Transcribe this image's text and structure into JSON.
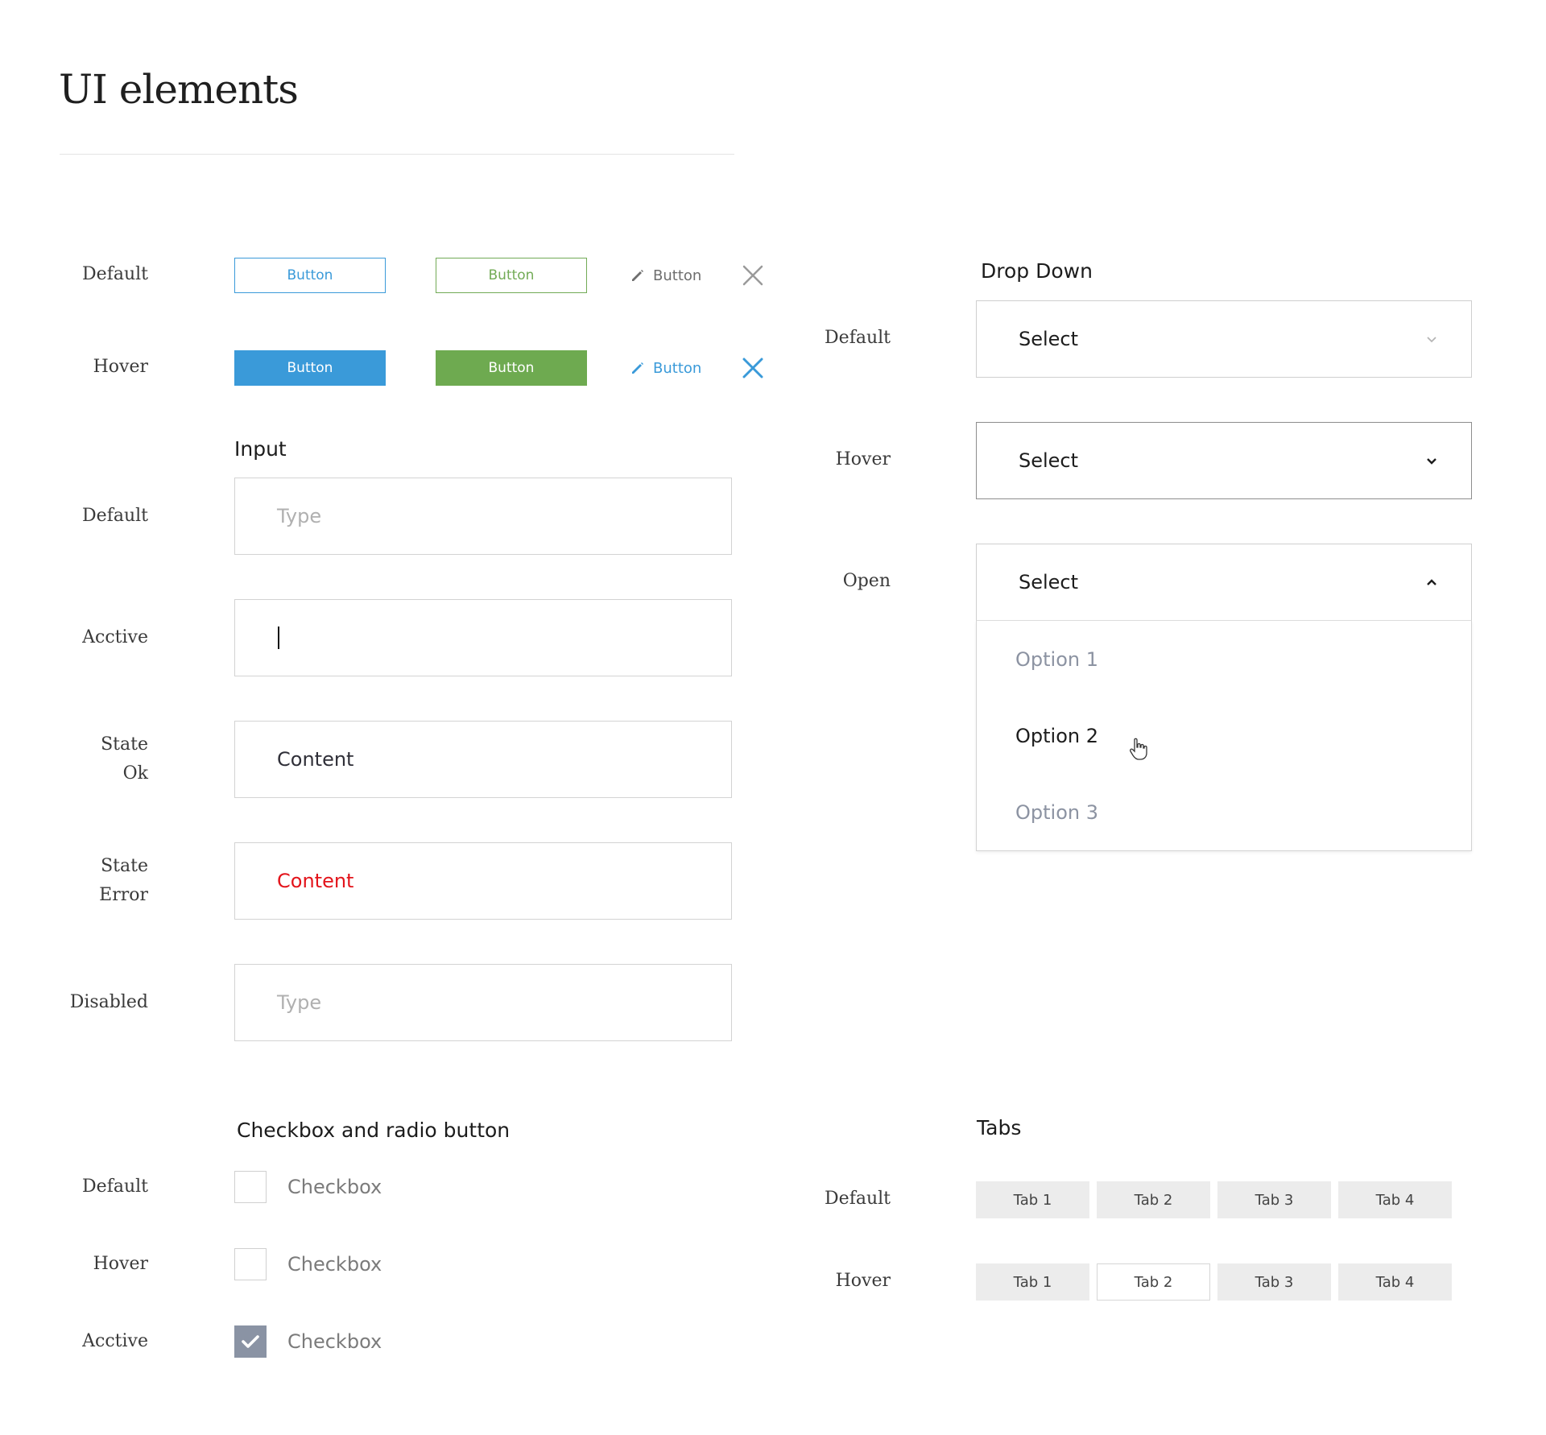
{
  "title": "UI elements",
  "colors": {
    "blue": "#3a9ad9",
    "green": "#6eaa50",
    "error": "#e3141b",
    "checkbox_checked": "#8a93a4"
  },
  "buttons": {
    "rows": [
      {
        "label": "Default",
        "blue": "Button",
        "green": "Button",
        "link": "Button"
      },
      {
        "label": "Hover",
        "blue": "Button",
        "green": "Button",
        "link": "Button"
      }
    ],
    "icons": [
      "pencil-icon",
      "close-icon"
    ]
  },
  "input": {
    "heading": "Input",
    "rows": [
      {
        "label": "Default",
        "placeholder": "Type"
      },
      {
        "label": "Acctive",
        "value": ""
      },
      {
        "label_line1": "State",
        "label_line2": "Ok",
        "value": "Content"
      },
      {
        "label_line1": "State",
        "label_line2": "Error",
        "value": "Content"
      },
      {
        "label": "Disabled",
        "placeholder": "Type"
      }
    ]
  },
  "dropdown": {
    "heading": "Drop Down",
    "rows": [
      {
        "label": "Default",
        "value": "Select",
        "icon": "chevron-down-icon"
      },
      {
        "label": "Hover",
        "value": "Select",
        "icon": "chevron-down-icon"
      },
      {
        "label": "Open",
        "value": "Select",
        "icon": "chevron-up-icon"
      }
    ],
    "options": [
      "Option 1",
      "Option 2",
      "Option 3"
    ],
    "hovered_option": "Option 2"
  },
  "checkbox": {
    "heading": "Checkbox and radio button",
    "rows": [
      {
        "label": "Default",
        "text": "Checkbox",
        "checked": false
      },
      {
        "label": "Hover",
        "text": "Checkbox",
        "checked": false
      },
      {
        "label": "Acctive",
        "text": "Checkbox",
        "checked": true
      }
    ]
  },
  "tabs": {
    "heading": "Tabs",
    "rows": [
      {
        "label": "Default",
        "tabs": [
          "Tab 1",
          "Tab 2",
          "Tab 3",
          "Tab 4"
        ]
      },
      {
        "label": "Hover",
        "tabs": [
          "Tab 1",
          "Tab 2",
          "Tab 3",
          "Tab 4"
        ],
        "hovered": "Tab 2"
      }
    ]
  }
}
